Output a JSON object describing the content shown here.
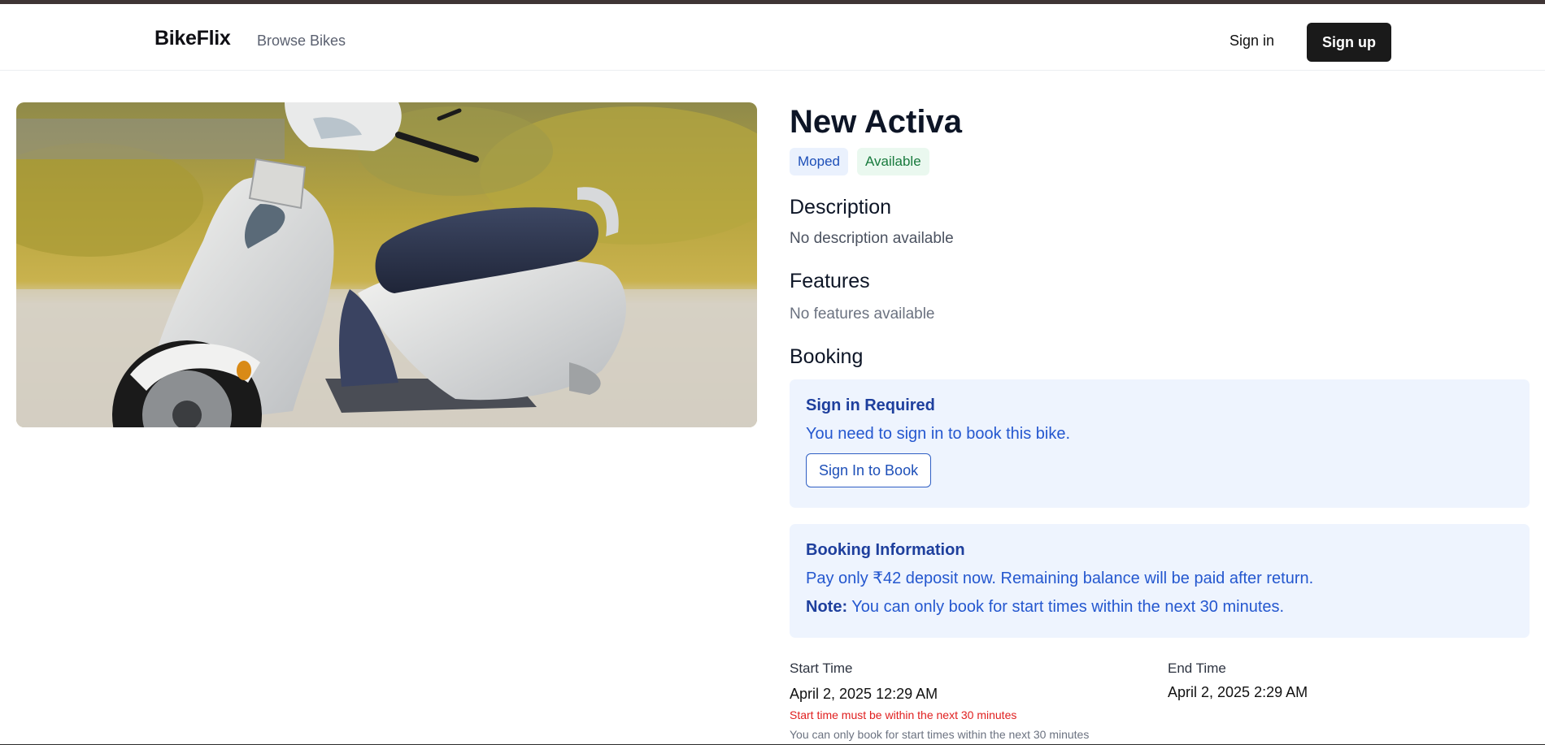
{
  "nav": {
    "brand": "BikeFlix",
    "browse_label": "Browse Bikes",
    "signin_label": "Sign in",
    "signup_label": "Sign up"
  },
  "bike": {
    "name": "New Activa",
    "category_badge": "Moped",
    "status_badge": "Available",
    "image_subject": "white-honda-activa-scooter"
  },
  "description": {
    "heading": "Description",
    "text": "No description available"
  },
  "features": {
    "heading": "Features",
    "text": "No features available"
  },
  "booking": {
    "heading": "Booking",
    "signin_panel": {
      "title": "Sign in Required",
      "text": "You need to sign in to book this bike.",
      "button_label": "Sign In to Book"
    },
    "info_panel": {
      "title": "Booking Information",
      "deposit_text": "Pay only ₹42 deposit now. Remaining balance will be paid after return.",
      "note_label": "Note:",
      "note_text": " You can only book for start times within the next 30 minutes."
    },
    "start_time": {
      "label": "Start Time",
      "value": "April 2, 2025 12:29 AM",
      "error": "Start time must be within the next 30 minutes",
      "hint": "You can only book for start times within the next 30 minutes"
    },
    "end_time": {
      "label": "End Time",
      "value": "April 2, 2025 2:29 AM"
    }
  },
  "colors": {
    "accent_blue": "#1d4fb8",
    "panel_bg": "#eef4fe",
    "dark_button": "#1a1a1a",
    "error_red": "#e02020",
    "success_green": "#187a3d"
  }
}
